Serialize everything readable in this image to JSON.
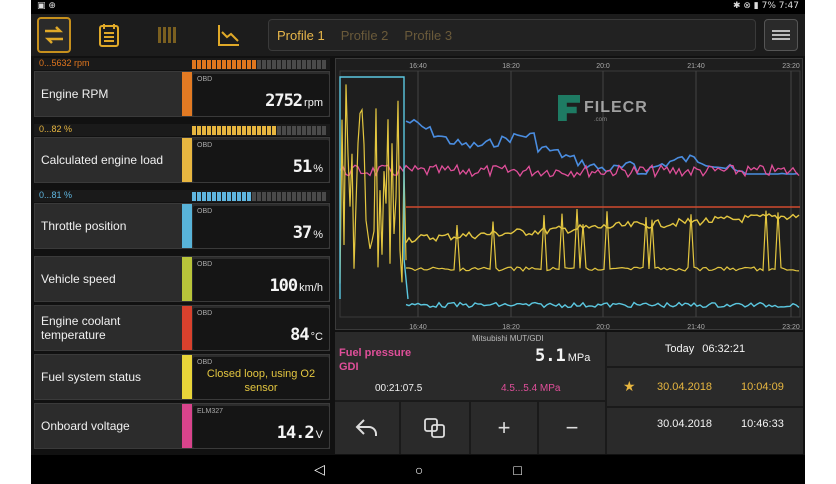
{
  "status_bar": {
    "left_icons": "▣ ⊕",
    "right_icons": "✱ ⊗ ▮",
    "battery": "7%",
    "time": "7:47"
  },
  "toolbar": {
    "profiles": [
      "Profile 1",
      "Profile 2",
      "Profile 3"
    ],
    "active_profile": "Profile 1",
    "icons": [
      "swap-icon",
      "sheet-icon",
      "grid-icon",
      "graph-icon",
      "menu-icon"
    ]
  },
  "gauges": [
    {
      "range": "0...5632 rpm",
      "range_color": "#e0761e",
      "name": "Engine RPM",
      "color": "#e27a23",
      "source": "OBD",
      "value": "2752",
      "unit": "rpm",
      "fill": 0.49
    },
    {
      "range": "0...82 %",
      "range_color": "#e7b640",
      "name": "Calculated engine load",
      "color": "#e7b640",
      "source": "OBD",
      "value": "51",
      "unit": "%",
      "fill": 0.62
    },
    {
      "range": "0...81 %",
      "range_color": "#5fb6e0",
      "name": "Throttle position",
      "color": "#58b3d8",
      "source": "OBD",
      "value": "37",
      "unit": "%",
      "fill": 0.46
    },
    {
      "name": "Vehicle speed",
      "color": "#b8c43a",
      "source": "OBD",
      "value": "100",
      "unit": "km/h"
    },
    {
      "name": "Engine coolant temperature",
      "color": "#d8412d",
      "source": "OBD",
      "value": "84",
      "unit": "°C"
    },
    {
      "name": "Fuel system status",
      "color": "#e8d439",
      "source": "OBD",
      "text_value": "Closed loop, using O2 sensor"
    },
    {
      "name": "Onboard voltage",
      "color": "#d8448c",
      "source": "ELM327",
      "value": "14.2",
      "unit": "V"
    }
  ],
  "chart": {
    "time_ticks": [
      "16:40",
      "18:20",
      "20:0",
      "21:40",
      "23:20"
    ],
    "watermark": "FILECR",
    "watermark_sub": ".com",
    "series_colors": [
      "#4a8de0",
      "#e04f9a",
      "#d04a2f",
      "#e3c640",
      "#5bc7e0"
    ]
  },
  "info": {
    "fuel_label": "Fuel pressure GDI",
    "fuel_source": "Mitsubishi MUT/GDI",
    "fuel_value": "5.1",
    "fuel_unit": "MPa",
    "duration": "00:21:07.5",
    "fuel_range": "4.5...5.4 MPa",
    "today_label": "Today",
    "today_time": "06:32:21",
    "star_date": "30.04.2018",
    "star_time": "10:04:09",
    "date2": "30.04.2018",
    "time2": "10:46:33",
    "plus": "+",
    "minus": "−"
  },
  "nav": {
    "back": "◁",
    "home": "○",
    "recents": "□"
  }
}
